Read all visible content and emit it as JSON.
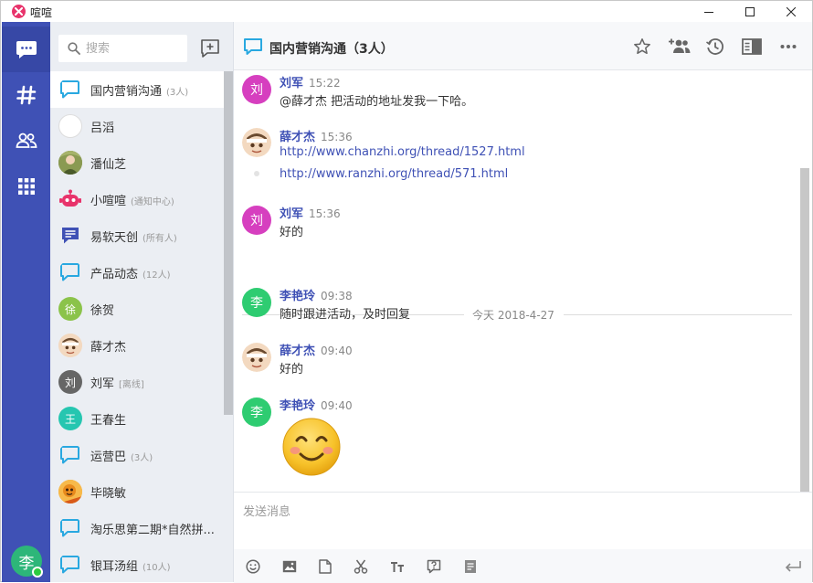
{
  "window": {
    "title": "喧喧"
  },
  "search": {
    "placeholder": "搜索"
  },
  "chats": [
    {
      "name": "国内营销沟通",
      "sub": "(3人)",
      "type": "group"
    },
    {
      "name": "吕滔",
      "sub": "",
      "type": "user-empty"
    },
    {
      "name": "潘仙芝",
      "sub": "",
      "type": "photo-green"
    },
    {
      "name": "小喧喧",
      "sub": "(通知中心)",
      "type": "robot"
    },
    {
      "name": "易软天创",
      "sub": "(所有人)",
      "type": "doc"
    },
    {
      "name": "产品动态",
      "sub": "(12人)",
      "type": "group"
    },
    {
      "name": "徐贺",
      "sub": "",
      "type": "letter",
      "letter": "徐",
      "color": "#8bc34a"
    },
    {
      "name": "薛才杰",
      "sub": "",
      "type": "photo-face"
    },
    {
      "name": "刘军",
      "sub": "[离线]",
      "type": "letter",
      "letter": "刘",
      "color": "#666666"
    },
    {
      "name": "王春生",
      "sub": "",
      "type": "letter",
      "letter": "王",
      "color": "#26c6b0"
    },
    {
      "name": "运营巴",
      "sub": "(3人)",
      "type": "group"
    },
    {
      "name": "毕晓敏",
      "sub": "",
      "type": "photo-orange"
    },
    {
      "name": "淘乐思第二期*自然拼...",
      "sub": "",
      "type": "group"
    },
    {
      "name": "银耳汤组",
      "sub": "(10人)",
      "type": "group"
    }
  ],
  "chat": {
    "title": "国内营销沟通（3人）",
    "header_icons": [
      "star-icon",
      "add-member-icon",
      "history-icon",
      "sidebar-icon",
      "more-icon"
    ],
    "messages": {
      "m1": {
        "name": "刘军",
        "time": "15:22",
        "avatar_letter": "刘",
        "text": "@薛才杰 把活动的地址发我一下哈。"
      },
      "m2": {
        "name": "薛才杰",
        "time": "15:36",
        "link1": "http://www.chanzhi.org/thread/1527.html",
        "link2": "http://www.ranzhi.org/thread/571.html"
      },
      "m3": {
        "name": "刘军",
        "time": "15:36",
        "avatar_letter": "刘",
        "text": "好的"
      },
      "divider": "今天 2018-4-27",
      "m4": {
        "name": "李艳玲",
        "time": "09:38",
        "avatar_letter": "李",
        "text": "随时跟进活动，及时回复"
      },
      "m5": {
        "name": "薛才杰",
        "time": "09:40",
        "text": "好的"
      },
      "m6": {
        "name": "李艳玲",
        "time": "09:40",
        "avatar_letter": "李",
        "emoji": "smiling-face-emoji"
      }
    },
    "input_placeholder": "发送消息",
    "toolbar_icons": [
      "emoji-icon",
      "image-icon",
      "file-icon",
      "scissors-icon",
      "font-size-icon",
      "help-icon",
      "note-icon",
      "send-icon"
    ]
  },
  "user": {
    "avatar_letter": "李",
    "status": "online"
  },
  "colors": {
    "primary": "#3f51b5",
    "magenta": "#d63fbf",
    "green": "#2ecc71"
  }
}
